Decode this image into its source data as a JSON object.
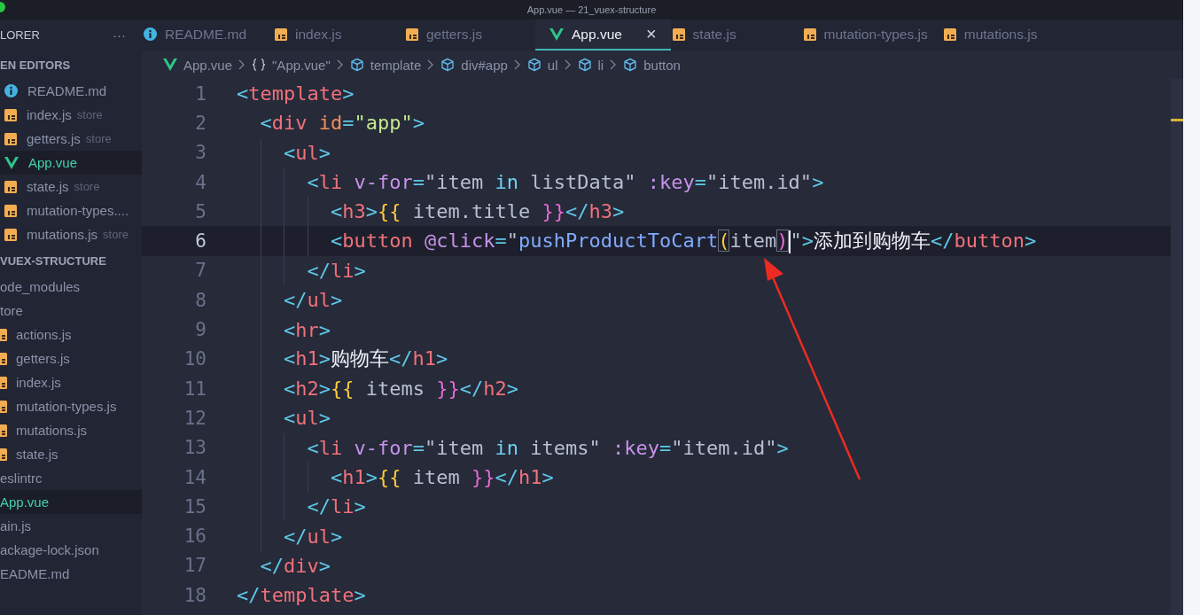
{
  "window": {
    "title": "App.vue — 21_vuex-structure"
  },
  "sidebar": {
    "title": "LORER",
    "more": "···",
    "open_editors": {
      "title": "EN EDITORS",
      "items": [
        {
          "kind": "info",
          "name": "README.md",
          "selected": false
        },
        {
          "kind": "js",
          "name": "index.js",
          "description": "store",
          "selected": false
        },
        {
          "kind": "js",
          "name": "getters.js",
          "description": "store",
          "selected": false
        },
        {
          "kind": "vue",
          "name": "App.vue",
          "selected": true
        },
        {
          "kind": "js",
          "name": "state.js",
          "description": "store",
          "selected": false
        },
        {
          "kind": "js",
          "name": "mutation-types....",
          "selected": false
        },
        {
          "kind": "js",
          "name": "mutations.js",
          "description": "store",
          "selected": false
        }
      ]
    },
    "project": {
      "title": "VUEX-STRUCTURE",
      "items": [
        {
          "name": "ode_modules",
          "selected": false
        },
        {
          "name": "tore",
          "selected": false,
          "children": [
            {
              "kind": "js",
              "name": "actions.js",
              "selected": false
            },
            {
              "kind": "js",
              "name": "getters.js",
              "selected": false
            },
            {
              "kind": "js",
              "name": "index.js",
              "selected": false
            },
            {
              "kind": "js",
              "name": "mutation-types.js",
              "selected": false
            },
            {
              "kind": "js",
              "name": "mutations.js",
              "selected": false
            },
            {
              "kind": "js",
              "name": "state.js",
              "selected": false
            }
          ]
        },
        {
          "name": "eslintrc",
          "selected": false
        },
        {
          "name": "App.vue",
          "selected": true
        },
        {
          "name": "ain.js",
          "selected": false
        },
        {
          "name": "ackage-lock.json",
          "selected": false
        },
        {
          "name": "EADME.md",
          "selected": false
        }
      ]
    }
  },
  "tabs": [
    {
      "kind": "info",
      "label": "README.md",
      "selected": false
    },
    {
      "kind": "js",
      "label": "index.js",
      "selected": false
    },
    {
      "kind": "js",
      "label": "getters.js",
      "selected": false
    },
    {
      "kind": "vue",
      "label": "App.vue",
      "selected": true,
      "close": "×"
    },
    {
      "kind": "js",
      "label": "state.js",
      "selected": false
    },
    {
      "kind": "js",
      "label": "mutation-types.js",
      "selected": false
    },
    {
      "kind": "js",
      "label": "mutations.js",
      "selected": false
    }
  ],
  "breadcrumb": [
    {
      "kind": "vue",
      "label": "App.vue"
    },
    {
      "kind": "braces",
      "label": "\"App.vue\""
    },
    {
      "kind": "element",
      "label": "template"
    },
    {
      "kind": "element",
      "label": "div#app"
    },
    {
      "kind": "element",
      "label": "ul"
    },
    {
      "kind": "element",
      "label": "li"
    },
    {
      "kind": "element",
      "label": "button"
    }
  ],
  "editor": {
    "lines": [
      {
        "number": "1",
        "current": false,
        "tokens": [
          {
            "kind": "bracket",
            "text": "<"
          },
          {
            "kind": "tag",
            "text": "template"
          },
          {
            "kind": "bracket",
            "text": ">"
          }
        ]
      },
      {
        "number": "2",
        "current": false,
        "tokens": [
          {
            "kind": "bracket",
            "text": "  <"
          },
          {
            "kind": "tag",
            "text": "div"
          },
          {
            "kind": "attribute",
            "text": " id"
          },
          {
            "kind": "bracket",
            "text": "="
          },
          {
            "kind": "string",
            "text": "\"app\""
          },
          {
            "kind": "bracket",
            "text": ">"
          }
        ]
      },
      {
        "number": "3",
        "current": false,
        "tokens": [
          {
            "kind": "bracket",
            "text": "    <"
          },
          {
            "kind": "tag",
            "text": "ul"
          },
          {
            "kind": "bracket",
            "text": ">"
          }
        ]
      },
      {
        "number": "4",
        "current": false,
        "tokens": [
          {
            "kind": "bracket",
            "text": "      <"
          },
          {
            "kind": "tag",
            "text": "li"
          },
          {
            "kind": "directive",
            "text": " v-for"
          },
          {
            "kind": "bracket",
            "text": "="
          },
          {
            "kind": "value",
            "text": "\"item "
          },
          {
            "kind": "keyword",
            "text": "in"
          },
          {
            "kind": "value",
            "text": " listData\""
          },
          {
            "kind": "directive",
            "text": " :key"
          },
          {
            "kind": "bracket",
            "text": "="
          },
          {
            "kind": "value",
            "text": "\"item.id\""
          },
          {
            "kind": "bracket",
            "text": ">"
          }
        ]
      },
      {
        "number": "5",
        "current": false,
        "tokens": [
          {
            "kind": "bracket",
            "text": "        <"
          },
          {
            "kind": "tag",
            "text": "h3"
          },
          {
            "kind": "bracket",
            "text": ">"
          },
          {
            "kind": "open",
            "text": "{{"
          },
          {
            "kind": "value",
            "text": " item.title "
          },
          {
            "kind": "close",
            "text": "}}"
          },
          {
            "kind": "bracket",
            "text": "</"
          },
          {
            "kind": "tag",
            "text": "h3"
          },
          {
            "kind": "bracket",
            "text": ">"
          }
        ]
      },
      {
        "number": "6",
        "current": true,
        "tokens": [
          {
            "kind": "bracket",
            "text": "        <"
          },
          {
            "kind": "tag",
            "text": "button"
          },
          {
            "kind": "directive",
            "text": " @click"
          },
          {
            "kind": "bracket",
            "text": "="
          },
          {
            "kind": "value",
            "text": "\""
          },
          {
            "kind": "function",
            "text": "pushProductToCart"
          },
          {
            "kind": "open",
            "text": "(",
            "matched": true
          },
          {
            "kind": "value",
            "text": "item"
          },
          {
            "kind": "close",
            "text": ")",
            "matched": true,
            "caret": true
          },
          {
            "kind": "value",
            "text": "\""
          },
          {
            "kind": "bracket",
            "text": ">"
          },
          {
            "kind": "text",
            "text": "添加到购物车"
          },
          {
            "kind": "bracket",
            "text": "</"
          },
          {
            "kind": "tag",
            "text": "button"
          },
          {
            "kind": "bracket",
            "text": ">"
          }
        ]
      },
      {
        "number": "7",
        "current": false,
        "tokens": [
          {
            "kind": "bracket",
            "text": "      </"
          },
          {
            "kind": "tag",
            "text": "li"
          },
          {
            "kind": "bracket",
            "text": ">"
          }
        ]
      },
      {
        "number": "8",
        "current": false,
        "tokens": [
          {
            "kind": "bracket",
            "text": "    </"
          },
          {
            "kind": "tag",
            "text": "ul"
          },
          {
            "kind": "bracket",
            "text": ">"
          }
        ]
      },
      {
        "number": "9",
        "current": false,
        "tokens": [
          {
            "kind": "bracket",
            "text": "    <"
          },
          {
            "kind": "tag",
            "text": "hr"
          },
          {
            "kind": "bracket",
            "text": ">"
          }
        ]
      },
      {
        "number": "10",
        "current": false,
        "tokens": [
          {
            "kind": "bracket",
            "text": "    <"
          },
          {
            "kind": "tag",
            "text": "h1"
          },
          {
            "kind": "bracket",
            "text": ">"
          },
          {
            "kind": "text",
            "text": "购物车"
          },
          {
            "kind": "bracket",
            "text": "</"
          },
          {
            "kind": "tag",
            "text": "h1"
          },
          {
            "kind": "bracket",
            "text": ">"
          }
        ]
      },
      {
        "number": "11",
        "current": false,
        "tokens": [
          {
            "kind": "bracket",
            "text": "    <"
          },
          {
            "kind": "tag",
            "text": "h2"
          },
          {
            "kind": "bracket",
            "text": ">"
          },
          {
            "kind": "open",
            "text": "{{"
          },
          {
            "kind": "value",
            "text": " items "
          },
          {
            "kind": "close",
            "text": "}}"
          },
          {
            "kind": "bracket",
            "text": "</"
          },
          {
            "kind": "tag",
            "text": "h2"
          },
          {
            "kind": "bracket",
            "text": ">"
          }
        ]
      },
      {
        "number": "12",
        "current": false,
        "tokens": [
          {
            "kind": "bracket",
            "text": "    <"
          },
          {
            "kind": "tag",
            "text": "ul"
          },
          {
            "kind": "bracket",
            "text": ">"
          }
        ]
      },
      {
        "number": "13",
        "current": false,
        "tokens": [
          {
            "kind": "bracket",
            "text": "      <"
          },
          {
            "kind": "tag",
            "text": "li"
          },
          {
            "kind": "directive",
            "text": " v-for"
          },
          {
            "kind": "bracket",
            "text": "="
          },
          {
            "kind": "value",
            "text": "\"item "
          },
          {
            "kind": "keyword",
            "text": "in"
          },
          {
            "kind": "value",
            "text": " items\""
          },
          {
            "kind": "directive",
            "text": " :key"
          },
          {
            "kind": "bracket",
            "text": "="
          },
          {
            "kind": "value",
            "text": "\"item.id\""
          },
          {
            "kind": "bracket",
            "text": ">"
          }
        ]
      },
      {
        "number": "14",
        "current": false,
        "tokens": [
          {
            "kind": "bracket",
            "text": "        <"
          },
          {
            "kind": "tag",
            "text": "h1"
          },
          {
            "kind": "bracket",
            "text": ">"
          },
          {
            "kind": "open",
            "text": "{{"
          },
          {
            "kind": "value",
            "text": " item "
          },
          {
            "kind": "close",
            "text": "}}"
          },
          {
            "kind": "bracket",
            "text": "</"
          },
          {
            "kind": "tag",
            "text": "h1"
          },
          {
            "kind": "bracket",
            "text": ">"
          }
        ]
      },
      {
        "number": "15",
        "current": false,
        "tokens": [
          {
            "kind": "bracket",
            "text": "      </"
          },
          {
            "kind": "tag",
            "text": "li"
          },
          {
            "kind": "bracket",
            "text": ">"
          }
        ]
      },
      {
        "number": "16",
        "current": false,
        "tokens": [
          {
            "kind": "bracket",
            "text": "    </"
          },
          {
            "kind": "tag",
            "text": "ul"
          },
          {
            "kind": "bracket",
            "text": ">"
          }
        ]
      },
      {
        "number": "17",
        "current": false,
        "tokens": [
          {
            "kind": "bracket",
            "text": "  </"
          },
          {
            "kind": "tag",
            "text": "div"
          },
          {
            "kind": "bracket",
            "text": ">"
          }
        ]
      },
      {
        "number": "18",
        "current": false,
        "tokens": [
          {
            "kind": "bracket",
            "text": "</"
          },
          {
            "kind": "tag",
            "text": "template"
          },
          {
            "kind": "bracket",
            "text": ">"
          }
        ]
      }
    ],
    "annotations": [
      {
        "kind": "arrow"
      }
    ]
  }
}
